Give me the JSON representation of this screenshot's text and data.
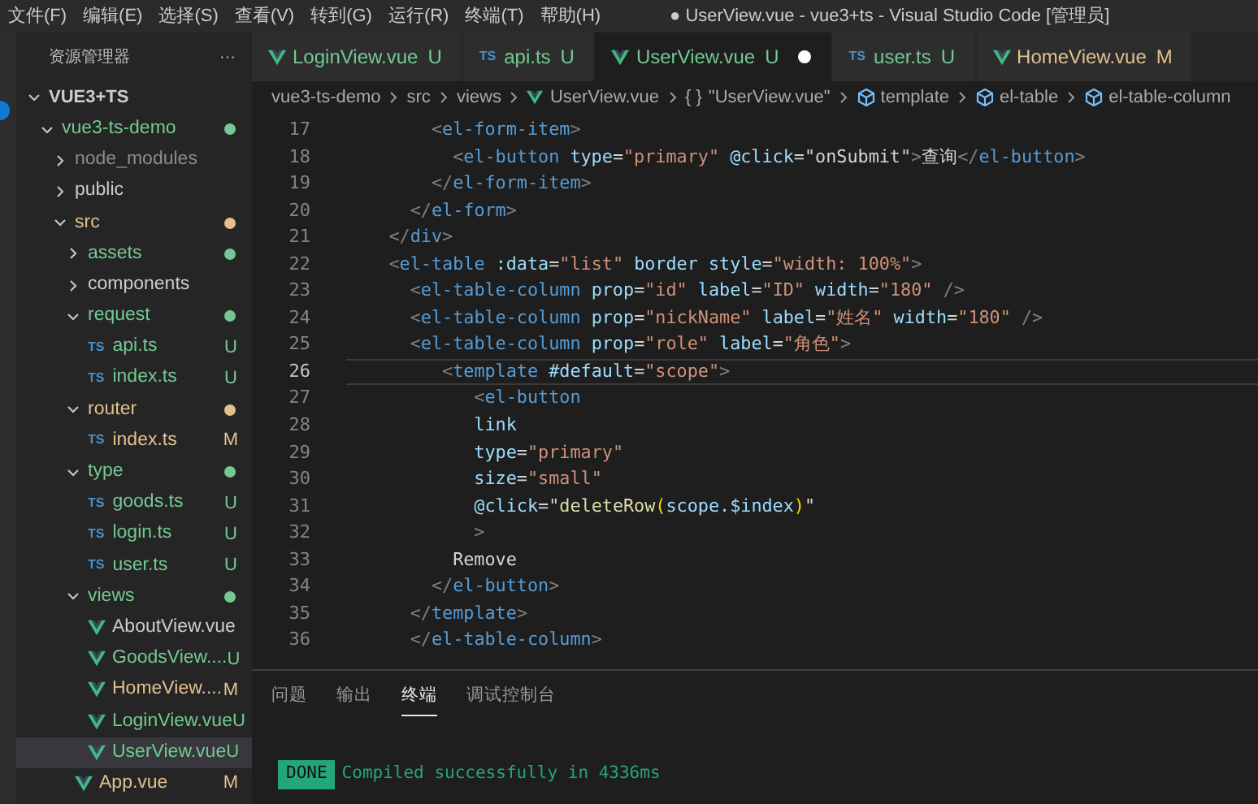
{
  "menu": [
    "文件(F)",
    "编辑(E)",
    "选择(S)",
    "查看(V)",
    "转到(G)",
    "运行(R)",
    "终端(T)",
    "帮助(H)"
  ],
  "window": {
    "title": "● UserView.vue - vue3+ts - Visual Studio Code [管理员]"
  },
  "sidebar": {
    "title": "资源管理器",
    "more": "···",
    "workspace": "VUE3+TS",
    "tree": [
      {
        "name": "vue3-ts-demo",
        "kind": "folder",
        "expanded": true,
        "color": "#73c991",
        "dot": true,
        "selected": false,
        "children": [
          {
            "name": "node_modules",
            "kind": "folder",
            "expanded": false,
            "color": "#8c8c8c",
            "dot": false,
            "selected": false
          },
          {
            "name": "public",
            "kind": "folder",
            "expanded": false,
            "color": "#cccccc",
            "dot": false,
            "selected": false
          },
          {
            "name": "src",
            "kind": "folder",
            "expanded": true,
            "color": "#e2c08d",
            "dot": true,
            "selected": false,
            "children": [
              {
                "name": "assets",
                "kind": "folder",
                "expanded": false,
                "color": "#73c991",
                "dot": true,
                "selected": false
              },
              {
                "name": "components",
                "kind": "folder",
                "expanded": false,
                "color": "#cccccc",
                "dot": false,
                "selected": false
              },
              {
                "name": "request",
                "kind": "folder",
                "expanded": true,
                "color": "#73c991",
                "dot": true,
                "selected": false,
                "children": [
                  {
                    "name": "api.ts",
                    "kind": "ts",
                    "icon_text": "TS",
                    "color": "#73c991",
                    "status": "U",
                    "selected": false
                  },
                  {
                    "name": "index.ts",
                    "kind": "ts",
                    "icon_text": "TS",
                    "color": "#73c991",
                    "status": "U",
                    "selected": false
                  }
                ]
              },
              {
                "name": "router",
                "kind": "folder",
                "expanded": true,
                "color": "#e2c08d",
                "dot": true,
                "selected": false,
                "children": [
                  {
                    "name": "index.ts",
                    "kind": "ts",
                    "icon_text": "TS",
                    "color": "#e2c08d",
                    "status": "M",
                    "selected": false
                  }
                ]
              },
              {
                "name": "type",
                "kind": "folder",
                "expanded": true,
                "color": "#73c991",
                "dot": true,
                "selected": false,
                "children": [
                  {
                    "name": "goods.ts",
                    "kind": "ts",
                    "icon_text": "TS",
                    "color": "#73c991",
                    "status": "U",
                    "selected": false
                  },
                  {
                    "name": "login.ts",
                    "kind": "ts",
                    "icon_text": "TS",
                    "color": "#73c991",
                    "status": "U",
                    "selected": false
                  },
                  {
                    "name": "user.ts",
                    "kind": "ts",
                    "icon_text": "TS",
                    "color": "#73c991",
                    "status": "U",
                    "selected": false
                  }
                ]
              },
              {
                "name": "views",
                "kind": "folder",
                "expanded": true,
                "color": "#73c991",
                "dot": true,
                "selected": false,
                "children": [
                  {
                    "name": "AboutView.vue",
                    "kind": "vue",
                    "color": "#cccccc",
                    "selected": false
                  },
                  {
                    "name": "GoodsView....",
                    "kind": "vue",
                    "color": "#73c991",
                    "status": "U",
                    "selected": false
                  },
                  {
                    "name": "HomeView....",
                    "kind": "vue",
                    "color": "#e2c08d",
                    "status": "M",
                    "selected": false
                  },
                  {
                    "name": "LoginView.vue",
                    "kind": "vue",
                    "color": "#73c991",
                    "status": "U",
                    "selected": false
                  },
                  {
                    "name": "UserView.vue",
                    "kind": "vue",
                    "color": "#73c991",
                    "status": "U",
                    "selected": true
                  }
                ]
              },
              {
                "name": "App.vue",
                "kind": "vue",
                "color": "#e2c08d",
                "status": "M",
                "selected": false
              }
            ]
          }
        ]
      }
    ]
  },
  "tabs": [
    {
      "label": "LoginView.vue",
      "kind": "vue",
      "status": "U",
      "selected": false,
      "dirty": false
    },
    {
      "label": "api.ts",
      "kind": "ts",
      "icon_text": "TS",
      "status": "U",
      "selected": false,
      "dirty": false
    },
    {
      "label": "UserView.vue",
      "kind": "vue",
      "status": "U",
      "selected": true,
      "dirty": true
    },
    {
      "label": "user.ts",
      "kind": "ts",
      "icon_text": "TS",
      "status": "U",
      "selected": false,
      "dirty": false
    },
    {
      "label": "HomeView.vue",
      "kind": "vue",
      "status": "M",
      "selected": false,
      "dirty": false
    }
  ],
  "breadcrumb": [
    {
      "label": "vue3-ts-demo",
      "kind": "folder"
    },
    {
      "label": "src",
      "kind": "folder"
    },
    {
      "label": "views",
      "kind": "folder"
    },
    {
      "label": "UserView.vue",
      "kind": "vue"
    },
    {
      "label": "\"UserView.vue\"",
      "kind": "braces",
      "icon_text": "{ }"
    },
    {
      "label": "template",
      "kind": "element"
    },
    {
      "label": "el-table",
      "kind": "element"
    },
    {
      "label": "el-table-column",
      "kind": "element"
    }
  ],
  "code": [
    {
      "number": "17",
      "current": false,
      "tokens": [
        {
          "kind": "p",
          "text": "        <"
        },
        {
          "kind": "tag",
          "text": "el-form-item"
        },
        {
          "kind": "p",
          "text": ">"
        }
      ]
    },
    {
      "number": "18",
      "current": false,
      "tokens": [
        {
          "kind": "p",
          "text": "          <"
        },
        {
          "kind": "tag",
          "text": "el-button"
        },
        {
          "kind": "attr",
          "text": " type"
        },
        {
          "kind": "txt",
          "text": "="
        },
        {
          "kind": "str",
          "text": "\"primary\""
        },
        {
          "kind": "attr",
          "text": " @click"
        },
        {
          "kind": "txt",
          "text": "=\"onSubmit\""
        },
        {
          "kind": "p",
          "text": ">"
        },
        {
          "kind": "txt",
          "text": "查询"
        },
        {
          "kind": "p",
          "text": "</"
        },
        {
          "kind": "tag",
          "text": "el-button"
        },
        {
          "kind": "p",
          "text": ">"
        }
      ]
    },
    {
      "number": "19",
      "current": false,
      "tokens": [
        {
          "kind": "p",
          "text": "        </"
        },
        {
          "kind": "tag",
          "text": "el-form-item"
        },
        {
          "kind": "p",
          "text": ">"
        }
      ]
    },
    {
      "number": "20",
      "current": false,
      "tokens": [
        {
          "kind": "p",
          "text": "      </"
        },
        {
          "kind": "tag",
          "text": "el-form"
        },
        {
          "kind": "p",
          "text": ">"
        }
      ]
    },
    {
      "number": "21",
      "current": false,
      "tokens": [
        {
          "kind": "p",
          "text": "    </"
        },
        {
          "kind": "tag",
          "text": "div"
        },
        {
          "kind": "p",
          "text": ">"
        }
      ]
    },
    {
      "number": "22",
      "current": false,
      "tokens": [
        {
          "kind": "p",
          "text": "    <"
        },
        {
          "kind": "tag",
          "text": "el-table"
        },
        {
          "kind": "attr",
          "text": " :data"
        },
        {
          "kind": "txt",
          "text": "="
        },
        {
          "kind": "str",
          "text": "\"list\""
        },
        {
          "kind": "attr",
          "text": " border style"
        },
        {
          "kind": "txt",
          "text": "="
        },
        {
          "kind": "str",
          "text": "\"width: 100%\""
        },
        {
          "kind": "p",
          "text": ">"
        }
      ]
    },
    {
      "number": "23",
      "current": false,
      "tokens": [
        {
          "kind": "p",
          "text": "      <"
        },
        {
          "kind": "tag",
          "text": "el-table-column"
        },
        {
          "kind": "attr",
          "text": " prop"
        },
        {
          "kind": "txt",
          "text": "="
        },
        {
          "kind": "str",
          "text": "\"id\""
        },
        {
          "kind": "attr",
          "text": " label"
        },
        {
          "kind": "txt",
          "text": "="
        },
        {
          "kind": "str",
          "text": "\"ID\""
        },
        {
          "kind": "attr",
          "text": " width"
        },
        {
          "kind": "txt",
          "text": "="
        },
        {
          "kind": "str",
          "text": "\"180\""
        },
        {
          "kind": "p",
          "text": " />"
        }
      ]
    },
    {
      "number": "24",
      "current": false,
      "tokens": [
        {
          "kind": "p",
          "text": "      <"
        },
        {
          "kind": "tag",
          "text": "el-table-column"
        },
        {
          "kind": "attr",
          "text": " prop"
        },
        {
          "kind": "txt",
          "text": "="
        },
        {
          "kind": "str",
          "text": "\"nickName\""
        },
        {
          "kind": "attr",
          "text": " label"
        },
        {
          "kind": "txt",
          "text": "="
        },
        {
          "kind": "str",
          "text": "\"姓名\""
        },
        {
          "kind": "attr",
          "text": " width"
        },
        {
          "kind": "txt",
          "text": "="
        },
        {
          "kind": "str",
          "text": "\"180\""
        },
        {
          "kind": "p",
          "text": " />"
        }
      ]
    },
    {
      "number": "25",
      "current": false,
      "tokens": [
        {
          "kind": "p",
          "text": "      <"
        },
        {
          "kind": "tag",
          "text": "el-table-column"
        },
        {
          "kind": "attr",
          "text": " prop"
        },
        {
          "kind": "txt",
          "text": "="
        },
        {
          "kind": "str",
          "text": "\"role\""
        },
        {
          "kind": "attr",
          "text": " label"
        },
        {
          "kind": "txt",
          "text": "="
        },
        {
          "kind": "str",
          "text": "\"角色\""
        },
        {
          "kind": "p",
          "text": ">"
        }
      ]
    },
    {
      "number": "26",
      "current": true,
      "tokens": [
        {
          "kind": "p",
          "text": "         <"
        },
        {
          "kind": "tag",
          "text": "template"
        },
        {
          "kind": "attr",
          "text": " #default"
        },
        {
          "kind": "txt",
          "text": "="
        },
        {
          "kind": "str",
          "text": "\"scope\""
        },
        {
          "kind": "p",
          "text": ">"
        }
      ]
    },
    {
      "number": "27",
      "current": false,
      "tokens": [
        {
          "kind": "p",
          "text": "            <"
        },
        {
          "kind": "tag",
          "text": "el-button"
        }
      ]
    },
    {
      "number": "28",
      "current": false,
      "tokens": [
        {
          "kind": "attr",
          "text": "            link"
        }
      ]
    },
    {
      "number": "29",
      "current": false,
      "tokens": [
        {
          "kind": "attr",
          "text": "            type"
        },
        {
          "kind": "txt",
          "text": "="
        },
        {
          "kind": "str",
          "text": "\"primary\""
        }
      ]
    },
    {
      "number": "30",
      "current": false,
      "tokens": [
        {
          "kind": "attr",
          "text": "            size"
        },
        {
          "kind": "txt",
          "text": "="
        },
        {
          "kind": "str",
          "text": "\"small\""
        }
      ]
    },
    {
      "number": "31",
      "current": false,
      "tokens": [
        {
          "kind": "attr",
          "text": "            @click"
        },
        {
          "kind": "txt",
          "text": "=\""
        },
        {
          "kind": "fn",
          "text": "deleteRow"
        },
        {
          "kind": "brk",
          "text": "("
        },
        {
          "kind": "attr",
          "text": "scope.$index"
        },
        {
          "kind": "brk",
          "text": ")"
        },
        {
          "kind": "txt",
          "text": "\""
        }
      ]
    },
    {
      "number": "32",
      "current": false,
      "tokens": [
        {
          "kind": "p",
          "text": "            >"
        }
      ]
    },
    {
      "number": "33",
      "current": false,
      "tokens": [
        {
          "kind": "txt",
          "text": "          Remove"
        }
      ]
    },
    {
      "number": "34",
      "current": false,
      "tokens": [
        {
          "kind": "p",
          "text": "        </"
        },
        {
          "kind": "tag",
          "text": "el-button"
        },
        {
          "kind": "p",
          "text": ">"
        }
      ]
    },
    {
      "number": "35",
      "current": false,
      "tokens": [
        {
          "kind": "p",
          "text": "      </"
        },
        {
          "kind": "tag",
          "text": "template"
        },
        {
          "kind": "p",
          "text": ">"
        }
      ]
    },
    {
      "number": "36",
      "current": false,
      "tokens": [
        {
          "kind": "p",
          "text": "      </"
        },
        {
          "kind": "tag",
          "text": "el-table-column"
        },
        {
          "kind": "p",
          "text": ">"
        }
      ]
    }
  ],
  "panel": {
    "tabs": [
      {
        "label": "问题",
        "selected": false
      },
      {
        "label": "输出",
        "selected": false
      },
      {
        "label": "终端",
        "selected": true
      },
      {
        "label": "调试控制台",
        "selected": false
      }
    ],
    "terminal": {
      "badge": "DONE",
      "message": "Compiled successfully in 4336ms"
    }
  }
}
